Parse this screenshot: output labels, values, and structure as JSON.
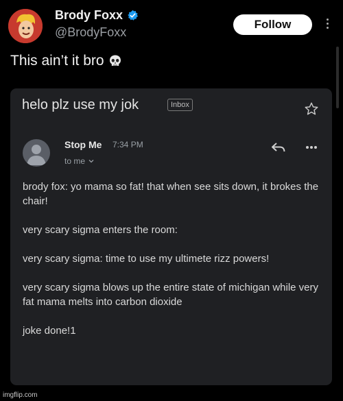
{
  "tweet": {
    "author_name": "Brody Foxx",
    "handle": "@BrodyFoxx",
    "follow_label": "Follow",
    "text": "This ain’t it bro"
  },
  "email": {
    "subject": "helo plz use my jok",
    "label": "Inbox",
    "sender": "Stop Me",
    "time": "7:34 PM",
    "recipient": "to me",
    "paragraphs": [
      "brody fox: yo mama so fat! that when see sits down, it brokes the chair!",
      "very scary sigma enters the room:",
      "very scary sigma: time to use my ultimete rizz powers!",
      "very scary sigma blows up the entire state of michigan while very fat mama melts into carbon dioxide",
      "joke done!1"
    ]
  },
  "icons": {
    "verified": "verified-badge-icon",
    "more_vertical": "more-vertical-icon",
    "skull": "skull-emoji-icon",
    "star": "star-outline-icon",
    "reply": "reply-arrow-icon",
    "more_horizontal": "more-horizontal-icon",
    "chevron": "chevron-down-icon"
  },
  "colors": {
    "background": "#000000",
    "card": "#1f2023",
    "verified": "#1d9bf0",
    "follow_bg": "#ffffff"
  },
  "watermark": "imgflip.com"
}
